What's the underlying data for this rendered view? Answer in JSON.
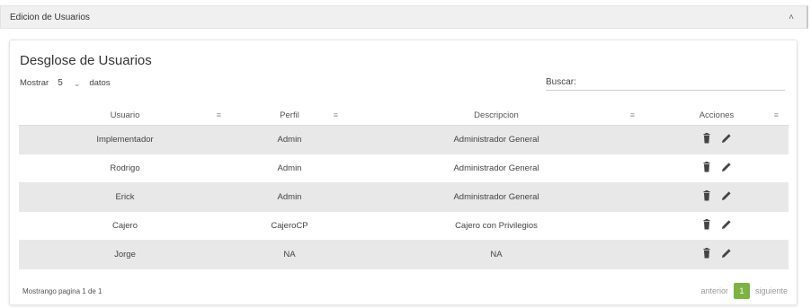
{
  "accordion": {
    "title": "Edicion de Usuarios"
  },
  "card": {
    "title": "Desglose de Usuarios",
    "length": {
      "prefix": "Mostrar",
      "value": "5",
      "suffix": "datos"
    },
    "search": {
      "label": "Buscar:",
      "value": ""
    }
  },
  "table": {
    "columns": [
      "Usuario",
      "Perfil",
      "Descripcion",
      "Acciones"
    ],
    "rows": [
      {
        "usuario": "Implementador",
        "perfil": "Admin",
        "descripcion": "Administrador General"
      },
      {
        "usuario": "Rodrigo",
        "perfil": "Admin",
        "descripcion": "Administrador General"
      },
      {
        "usuario": "Erick",
        "perfil": "Admin",
        "descripcion": "Administrador General"
      },
      {
        "usuario": "Cajero",
        "perfil": "CajeroCP",
        "descripcion": "Cajero con Privilegios"
      },
      {
        "usuario": "Jorge",
        "perfil": "NA",
        "descripcion": "NA"
      }
    ],
    "action_icons": [
      "trash-icon",
      "pencil-icon"
    ]
  },
  "footer": {
    "info": "Mostrango pagina 1 de 1",
    "prev": "anterior",
    "page": "1",
    "next": "siguiente"
  },
  "colors": {
    "accent": "#7cb342",
    "row_alt": "#e8e8e8",
    "header_bg": "#f0f0f0"
  }
}
